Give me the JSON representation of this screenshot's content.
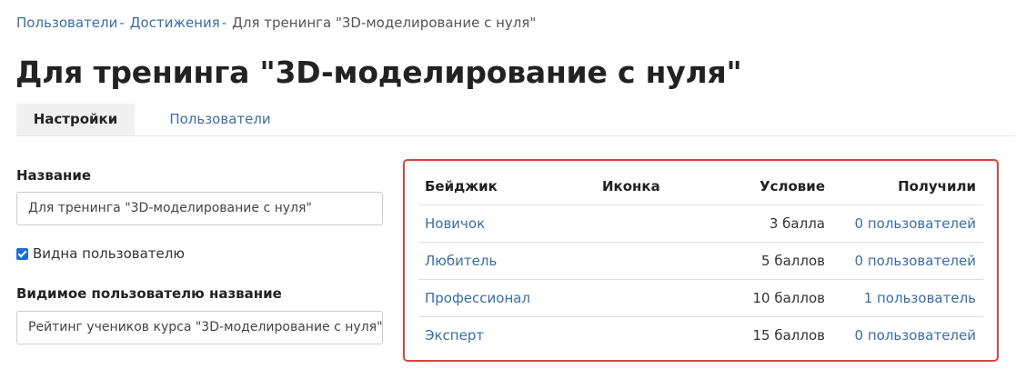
{
  "breadcrumb": {
    "items": [
      "Пользователи",
      "Достижения"
    ],
    "separator": "-",
    "current": "Для тренинга \"3D-моделирование с нуля\""
  },
  "page_title": "Для тренинга \"3D-моделирование с нуля\"",
  "tabs": [
    {
      "label": "Настройки",
      "active": true
    },
    {
      "label": "Пользователи",
      "active": false
    }
  ],
  "form": {
    "name_label": "Название",
    "name_value": "Для тренинга \"3D-моделирование с нуля\"",
    "visible_checkbox_label": "Видна пользователю",
    "visible_checked": true,
    "visible_name_label": "Видимое пользователю название",
    "visible_name_value": "Рейтинг учеников курса \"3D-моделирование с нуля\""
  },
  "badges_table": {
    "headers": {
      "badge": "Бейджик",
      "icon": "Иконка",
      "condition": "Условие",
      "received": "Получили"
    },
    "rows": [
      {
        "badge": "Новичок",
        "condition": "3 балла",
        "received": "0 пользователей"
      },
      {
        "badge": "Любитель",
        "condition": "5 баллов",
        "received": "0 пользователей"
      },
      {
        "badge": "Профессионал",
        "condition": "10 баллов",
        "received": "1 пользователь"
      },
      {
        "badge": "Эксперт",
        "condition": "15 баллов",
        "received": "0 пользователей"
      }
    ]
  },
  "colors": {
    "link": "#3a6ea5",
    "highlight_border": "#d9443f",
    "checkbox": "#1a6fd6"
  }
}
